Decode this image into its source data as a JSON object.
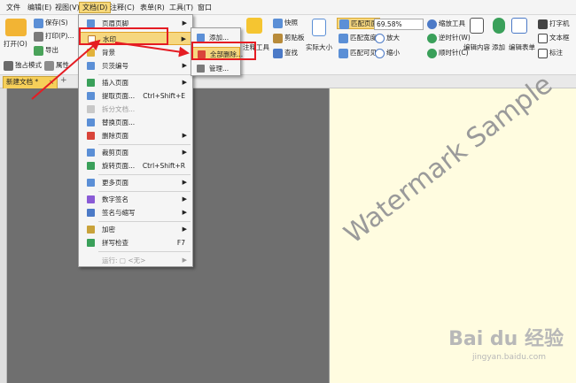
{
  "menubar": {
    "items": [
      "文件",
      "编辑(E)",
      "视图(V)",
      "文档(D)",
      "注释(C)",
      "表单(R)",
      "工具(T)",
      "窗口"
    ]
  },
  "ribbon": {
    "open": "打开(O)",
    "save": "保存(S)",
    "print": "打印(P)...",
    "export": "导出",
    "single_mode": "独占模式",
    "attr": "属性",
    "annotate_tool": "注释工具",
    "snapshot": "快照",
    "clipboard": "剪贴板",
    "find": "查找",
    "actual_size": "实际大小",
    "fit_page": "匹配页面",
    "fit_width": "匹配宽度",
    "fit_visible": "匹配可见",
    "zoom_value": "69.58%",
    "zoom_in": "放大",
    "zoom_out": "缩小",
    "zoom_tool": "缩放工具",
    "rotate_ccw": "逆时针(W)",
    "rotate_cw": "顺时针(C)",
    "edit_content": "编辑内容",
    "add": "添加",
    "edit_form": "编辑表单",
    "typewriter": "打字机",
    "textbox": "文本框",
    "callout": "标注"
  },
  "tabs": {
    "doc_tab": "新建文档 *"
  },
  "watermark": "Watermark Sample",
  "doc_menu": {
    "items": [
      {
        "label": "页眉页脚",
        "arrow": "▶"
      },
      {
        "label": "水印",
        "arrow": "▶"
      },
      {
        "label": "背景",
        "arrow": "▶"
      },
      {
        "label": "贝茨编号",
        "arrow": "▶"
      },
      {
        "label": "插入页面",
        "arrow": "▶"
      },
      {
        "label": "提取页面...",
        "shortcut": "Ctrl+Shift+E"
      },
      {
        "label": "拆分文档..."
      },
      {
        "label": "替换页面..."
      },
      {
        "label": "删除页面",
        "arrow": "▶"
      },
      {
        "label": "裁剪页面",
        "arrow": "▶"
      },
      {
        "label": "旋转页面...",
        "shortcut": "Ctrl+Shift+R"
      },
      {
        "label": "更多页面",
        "arrow": "▶"
      },
      {
        "label": "数字签名",
        "arrow": "▶"
      },
      {
        "label": "签名与缩写",
        "arrow": "▶"
      },
      {
        "label": "加密",
        "arrow": "▶"
      },
      {
        "label": "拼写检查",
        "shortcut": "F7"
      },
      {
        "label": "运行: ▢ <无>",
        "arrow": "▶"
      }
    ]
  },
  "watermark_submenu": {
    "items": [
      "添加...",
      "全部删除...",
      "管理..."
    ]
  },
  "branding": {
    "baidu": "Bai du 经验",
    "url": "jingyan.baidu.com"
  },
  "colors": {
    "highlight": "#f6d77f",
    "annotation_red": "#e51c23",
    "page_bg": "#fffce0",
    "workspace": "#6f6f6f"
  }
}
